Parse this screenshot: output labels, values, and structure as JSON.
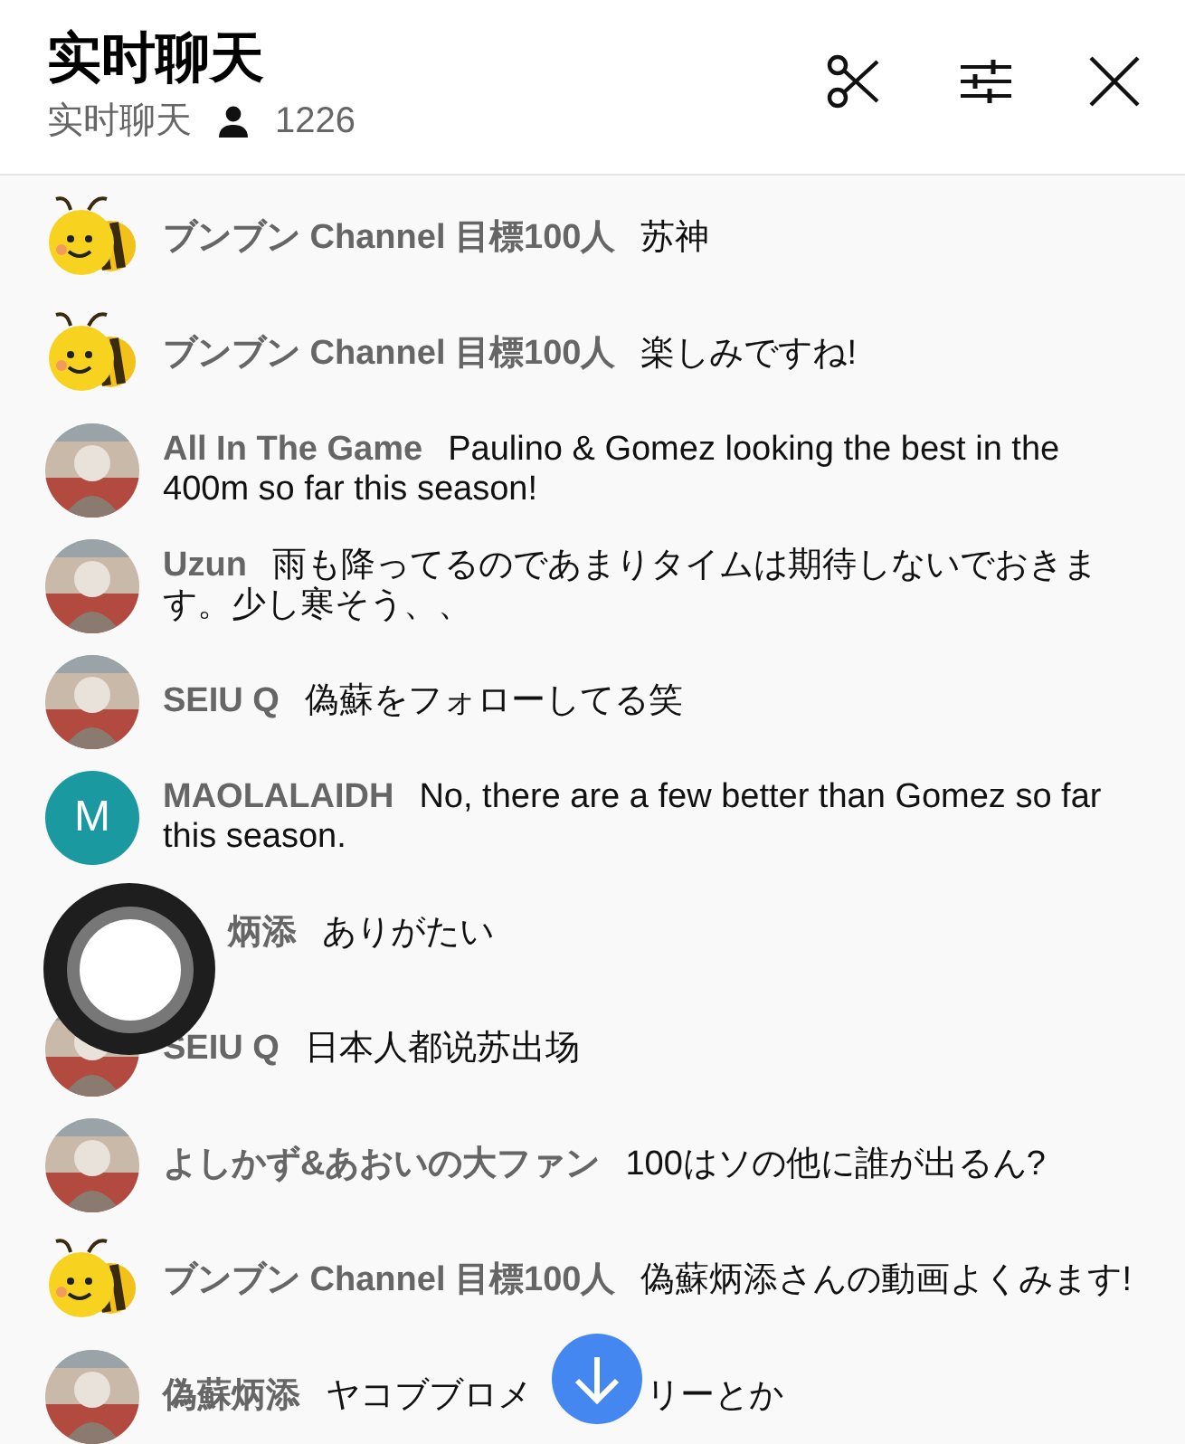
{
  "header": {
    "title": "实时聊天",
    "subtitle": "实时聊天",
    "viewer_count": "1226"
  },
  "messages": [
    {
      "avatar": {
        "kind": "bee"
      },
      "author": "ブンブン Channel 目標100人",
      "message": "苏神"
    },
    {
      "avatar": {
        "kind": "bee"
      },
      "author": "ブンブン Channel 目標100人",
      "message": "楽しみですね!"
    },
    {
      "author": "All In The Game",
      "message": "Paulino & Gomez looking the best in the 400m so far this season!"
    },
    {
      "author": "Uzun",
      "message": "雨も降ってるのであまりタイムは期待しないでおきます。少し寒そう、、"
    },
    {
      "author": "SEIU Q",
      "message": "偽蘇をフォローしてる笑"
    },
    {
      "avatar": {
        "kind": "letter",
        "letter": "M",
        "color": "#1a9aa0"
      },
      "author": "MAOLALAIDH",
      "message": "No, there are a few better than Gomez so far this season."
    },
    {
      "avatar": {
        "kind": "hidden"
      },
      "author": "炳添",
      "message": "ありがたい"
    },
    {
      "author": "SEIU Q",
      "message": "日本人都说苏出场"
    },
    {
      "author": "よしかず&あおいの大ファン",
      "message": "100はソの他に誰が出るん?"
    },
    {
      "avatar": {
        "kind": "bee"
      },
      "author": "ブンブン Channel 目標100人",
      "message": "偽蘇炳添さんの動画よくみます!"
    },
    {
      "author": "偽蘇炳添",
      "message": "ヤコブブロメ",
      "message_after": "リーとか"
    }
  ]
}
